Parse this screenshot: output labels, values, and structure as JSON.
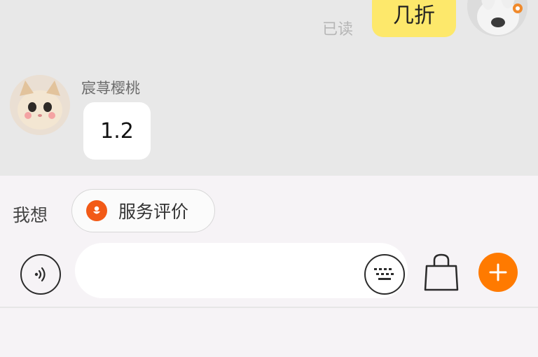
{
  "chat": {
    "read_status": "已读",
    "my_message": "几折",
    "sender_name": "宸荨樱桃",
    "other_message": "1.2"
  },
  "composer": {
    "want_label": "我想",
    "quick_action": "服务评价",
    "input_placeholder": "",
    "icons": [
      "voice-icon",
      "keyboard-icon",
      "shopping-bag-icon",
      "plus-icon"
    ]
  },
  "colors": {
    "my_bubble": "#fde86b",
    "accent_orange": "#ff7a00",
    "chip_icon": "#f25a17"
  }
}
